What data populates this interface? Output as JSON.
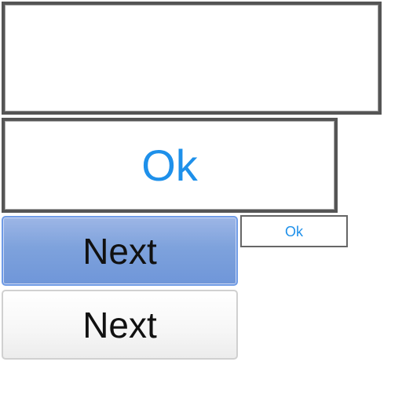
{
  "buttons": {
    "ok_large_label": "Ok",
    "ok_small_label": "Ok",
    "next_primary_label": "Next",
    "next_secondary_label": "Next"
  },
  "colors": {
    "ok_text": "#1e90ea",
    "primary_fill": "#7ea2dc",
    "border_dark": "#555555"
  }
}
